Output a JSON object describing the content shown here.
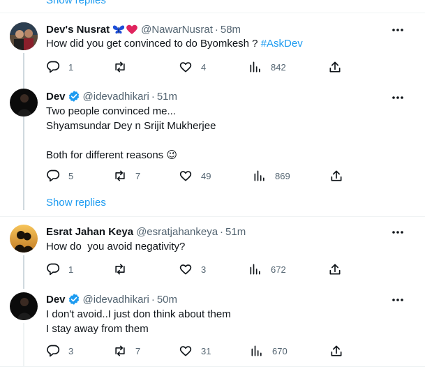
{
  "top_show_replies": "Show replies",
  "tweets": [
    {
      "name": "Dev's Nusrat",
      "emoji": [
        "butterfly",
        "heart"
      ],
      "handle": "@NawarNusrat",
      "time": "58m",
      "text_parts": [
        "How did you get convinced to do Byomkesh ? "
      ],
      "hashtag": "#AskDev",
      "replies": "1",
      "retweets": "",
      "likes": "4",
      "views": "842"
    },
    {
      "name": "Dev",
      "verified": true,
      "handle": "@idevadhikari",
      "time": "51m",
      "text": "Two people convinced me...\nShyamsundar Dey n Srijit Mukherjee\n\nBoth for different reasons 😉",
      "replies": "5",
      "retweets": "7",
      "likes": "49",
      "views": "869"
    },
    {
      "name": "Esrat Jahan Keya",
      "handle": "@esratjahankeya",
      "time": "51m",
      "text": "How do  you avoid negativity?",
      "replies": "1",
      "retweets": "",
      "likes": "3",
      "views": "672"
    },
    {
      "name": "Dev",
      "verified": true,
      "handle": "@idevadhikari",
      "time": "50m",
      "text": "I don't avoid..I just don think about them\nI stay away from them",
      "replies": "3",
      "retweets": "7",
      "likes": "31",
      "views": "670"
    }
  ],
  "mid_show_replies": "Show replies",
  "colors": {
    "accent": "#1d9bf0",
    "text": "#0f1419",
    "muted": "#536471",
    "divider": "#eff3f4",
    "heart": "#e0245e",
    "butterfly": "#1d4ed8"
  }
}
